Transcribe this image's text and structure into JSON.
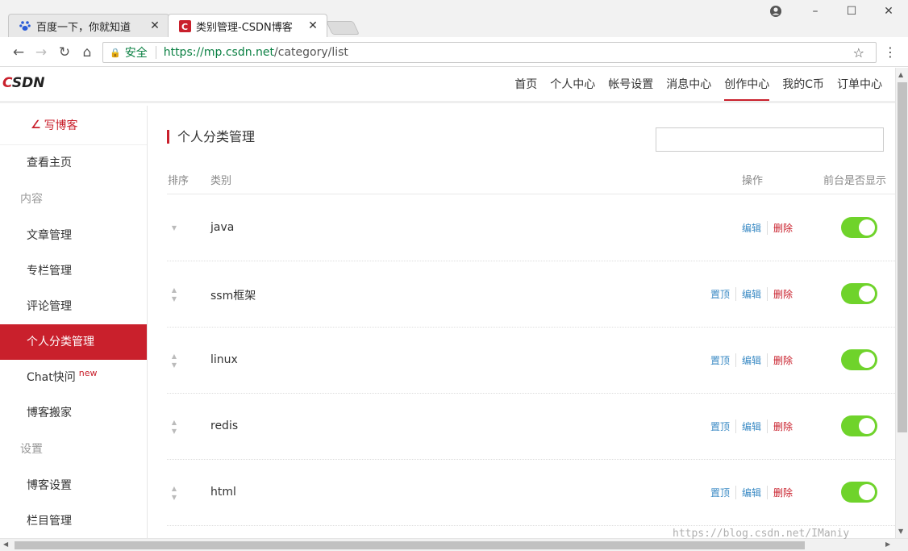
{
  "browser": {
    "tabs": [
      {
        "title": "百度一下，你就知道",
        "icon": "baidu-paw-icon"
      },
      {
        "title": "类别管理-CSDN博客",
        "icon": "csdn-c-icon"
      }
    ],
    "close_glyph": "✕",
    "address": {
      "secure_label": "安全",
      "url_host": "https://mp.csdn.net",
      "url_path": "/category/list"
    }
  },
  "header": {
    "logo": "CSDN",
    "nav": [
      "首页",
      "个人中心",
      "帐号设置",
      "消息中心",
      "创作中心",
      "我的C币",
      "订单中心"
    ],
    "active_nav": "创作中心"
  },
  "sidebar": {
    "write_label": "写博客",
    "home": "查看主页",
    "group_content": "内容",
    "items": [
      "文章管理",
      "专栏管理",
      "评论管理",
      "个人分类管理",
      "Chat快问",
      "博客搬家"
    ],
    "new_badge": "new",
    "group_settings": "设置",
    "settings_items": [
      "博客设置",
      "栏目管理"
    ],
    "active_item": "个人分类管理"
  },
  "main": {
    "title": "个人分类管理",
    "search_value": "",
    "columns": {
      "sort": "排序",
      "category": "类别",
      "ops": "操作",
      "show": "前台是否显示"
    },
    "op_labels": {
      "top": "置顶",
      "edit": "编辑",
      "delete": "删除"
    },
    "rows": [
      {
        "name": "java",
        "show_on_front": true
      },
      {
        "name": "ssm框架",
        "show_on_front": true
      },
      {
        "name": "linux",
        "show_on_front": true
      },
      {
        "name": "redis",
        "show_on_front": true
      },
      {
        "name": "html",
        "show_on_front": true
      }
    ]
  },
  "watermark": "https://blog.csdn.net/IManiy",
  "colors": {
    "accent": "#c9202c",
    "toggle_on": "#6fd32b",
    "link": "#3a8ac4"
  }
}
